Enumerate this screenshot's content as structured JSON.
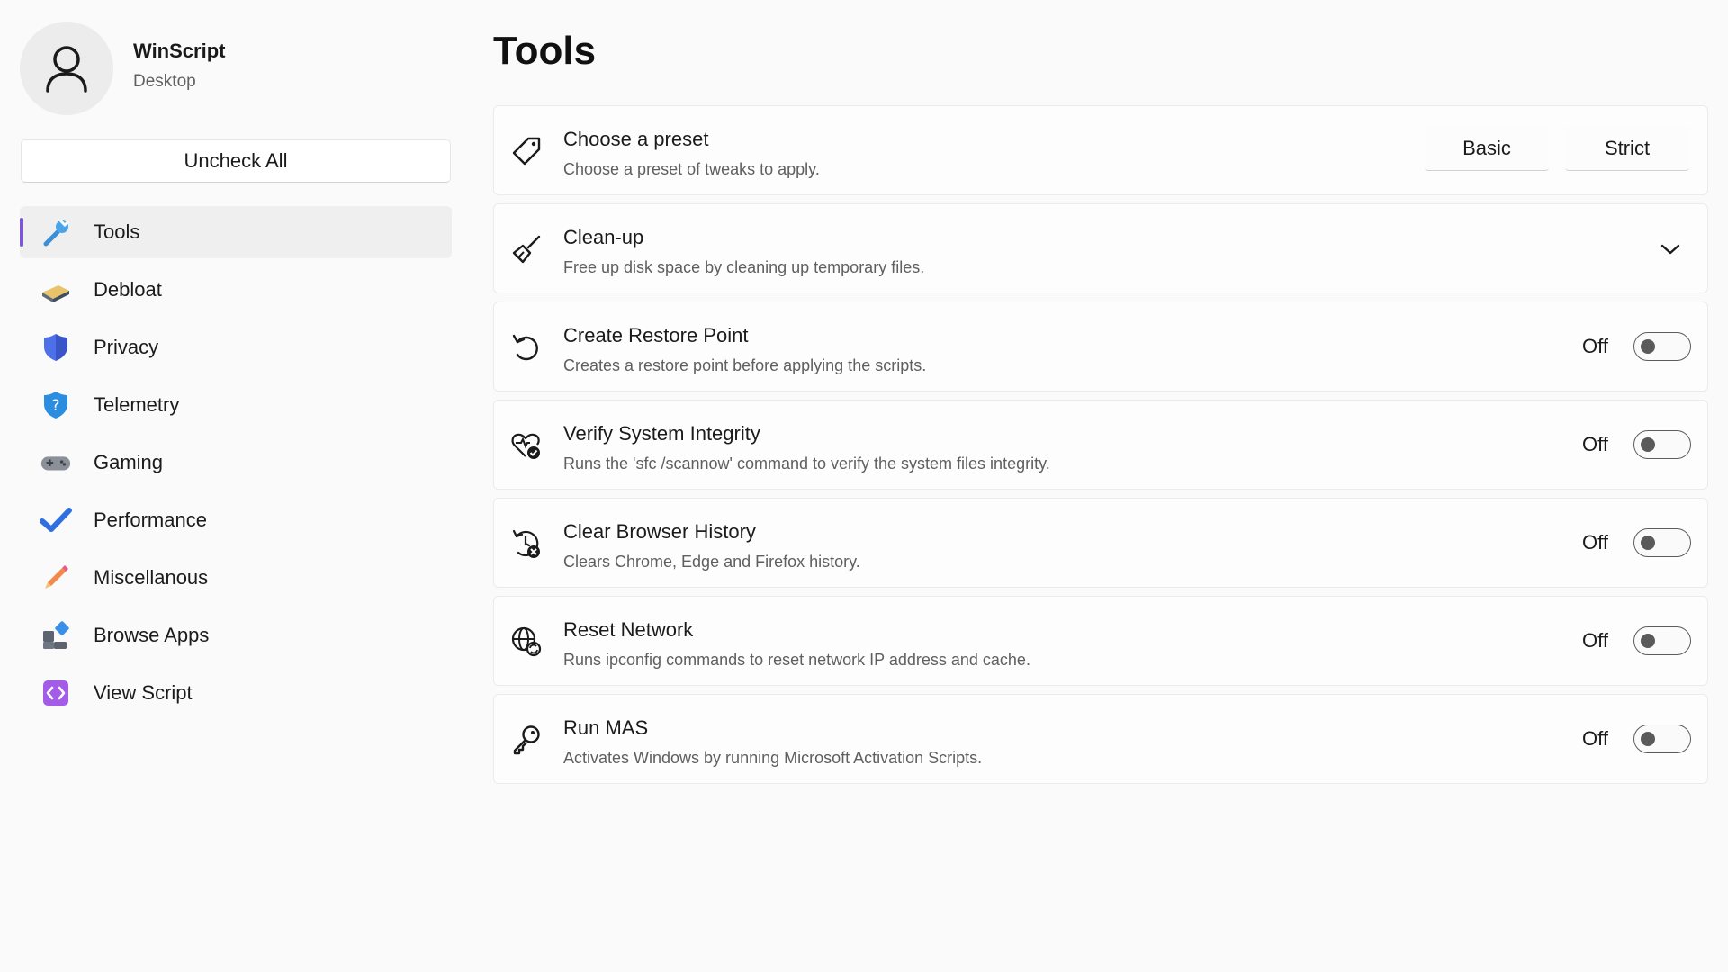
{
  "app": {
    "name": "WinScript",
    "subtitle": "Desktop"
  },
  "sidebar": {
    "uncheck_all": "Uncheck All",
    "items": [
      {
        "label": "Tools",
        "icon": "wrench-icon",
        "active": true
      },
      {
        "label": "Debloat",
        "icon": "eraser-icon"
      },
      {
        "label": "Privacy",
        "icon": "shield-icon"
      },
      {
        "label": "Telemetry",
        "icon": "shield-question-icon"
      },
      {
        "label": "Gaming",
        "icon": "gamepad-icon"
      },
      {
        "label": "Performance",
        "icon": "checkmark-icon"
      },
      {
        "label": "Miscellanous",
        "icon": "pencil-icon"
      },
      {
        "label": "Browse Apps",
        "icon": "apps-icon"
      },
      {
        "label": "View Script",
        "icon": "code-icon"
      }
    ]
  },
  "main": {
    "title": "Tools",
    "cards": [
      {
        "title": "Choose a preset",
        "desc": "Choose a preset of tweaks to apply.",
        "icon": "tag-icon",
        "presets": [
          "Basic",
          "Strict"
        ]
      },
      {
        "title": "Clean-up",
        "desc": "Free up disk space by cleaning up temporary files.",
        "icon": "broom-icon"
      },
      {
        "title": "Create Restore Point",
        "desc": "Creates a restore point before applying the scripts.",
        "icon": "undo-icon",
        "toggle": "Off"
      },
      {
        "title": "Verify System Integrity",
        "desc": "Runs the 'sfc /scannow' command to verify the system files integrity.",
        "icon": "heart-check-icon",
        "toggle": "Off"
      },
      {
        "title": "Clear Browser History",
        "desc": "Clears Chrome, Edge and Firefox history.",
        "icon": "history-clear-icon",
        "toggle": "Off"
      },
      {
        "title": "Reset Network",
        "desc": "Runs ipconfig commands to reset network IP address and cache.",
        "icon": "globe-sync-icon",
        "toggle": "Off"
      },
      {
        "title": "Run MAS",
        "desc": "Activates Windows by running Microsoft Activation Scripts.",
        "icon": "key-icon",
        "toggle": "Off"
      }
    ]
  },
  "colors": {
    "accent": "#7b57d6",
    "background": "#fafafa",
    "card": "#fdfdfd"
  }
}
